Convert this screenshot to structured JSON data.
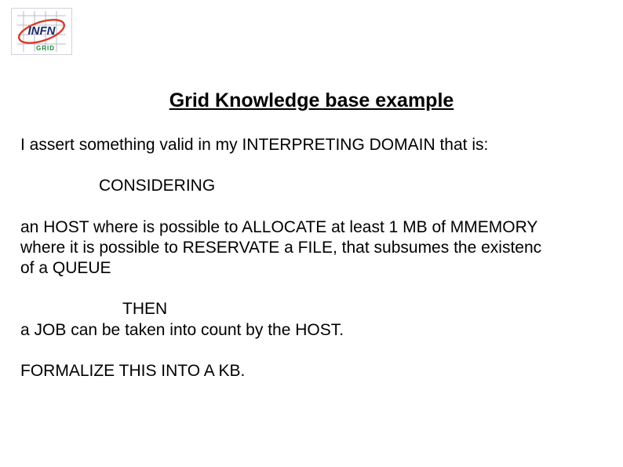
{
  "logo": {
    "name": "INFN GRID"
  },
  "title": "Grid Knowledge base example",
  "body": {
    "intro": "I assert something valid in my INTERPRETING DOMAIN that is:",
    "considering": "CONSIDERING",
    "host": "an HOST where is possible to ALLOCATE at least 1 MB of MMEMORY\nwhere it is possible to RESERVATE a FILE, that subsumes the existenc\nof a QUEUE",
    "then": "THEN",
    "job": "a JOB can be taken into count by the HOST.",
    "formalize": "FORMALIZE THIS INTO A KB."
  }
}
